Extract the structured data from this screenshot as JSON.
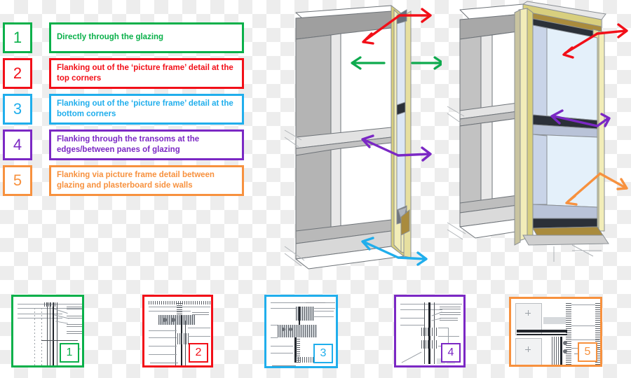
{
  "legend": {
    "items": [
      {
        "number": "1",
        "text": "Directly through the glazing",
        "color": "#0ab04a"
      },
      {
        "number": "2",
        "text": "Flanking out of the ‘picture frame’ detail at the top corners",
        "color": "#f20f18"
      },
      {
        "number": "3",
        "text": "Flanking out of the ‘picture frame’ detail at the bottom corners",
        "color": "#20aeec"
      },
      {
        "number": "4",
        "text": "Flanking through the transoms at the edges/between panes of glazing",
        "color": "#7b28c4"
      },
      {
        "number": "5",
        "text": "Flanking via picture frame detail between glazing and plasterboard side walls",
        "color": "#f7913e"
      }
    ]
  },
  "thumbnails": [
    {
      "badge": "1",
      "color": "#0ab04a",
      "name": "detail-drawing-1"
    },
    {
      "badge": "2",
      "color": "#f20f18",
      "name": "detail-drawing-2"
    },
    {
      "badge": "3",
      "color": "#20aeec",
      "name": "detail-drawing-3"
    },
    {
      "badge": "4",
      "color": "#7b28c4",
      "name": "detail-drawing-4"
    },
    {
      "badge": "5",
      "color": "#f7913e",
      "name": "detail-drawing-5"
    }
  ],
  "illustrations": {
    "left": {
      "name": "interior-cutaway-view",
      "arrows": [
        {
          "id": "2",
          "color": "#f20f18",
          "label": "top-corner-flanking"
        },
        {
          "id": "1",
          "color": "#0eaa4e",
          "label": "through-glazing"
        },
        {
          "id": "4",
          "color": "#7b28c4",
          "label": "transom-flanking"
        },
        {
          "id": "3",
          "color": "#20aeec",
          "label": "bottom-corner-flanking"
        }
      ]
    },
    "right": {
      "name": "exterior-glazing-view",
      "arrows": [
        {
          "id": "2",
          "color": "#f20f18",
          "label": "top-corner-flanking"
        },
        {
          "id": "4",
          "color": "#7b28c4",
          "label": "transom-flanking"
        },
        {
          "id": "5",
          "color": "#f7913e",
          "label": "picture-frame-side-wall-flanking"
        }
      ]
    }
  },
  "palette": {
    "frame_yellow": "#f2edb8",
    "frame_yellow_dark": "#d8cf7e",
    "glass_blue": "#e4f0fa",
    "glass_blue_dark": "#c3d0e8",
    "wall_grey": "#b9b9b9",
    "wall_grey_light": "#d0d0d0",
    "outline": "#6e7378",
    "timber": "#a98b3d"
  }
}
